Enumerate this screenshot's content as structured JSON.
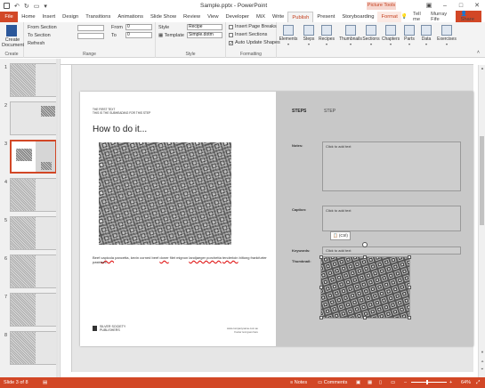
{
  "window": {
    "title": "Sample.pptx - PowerPoint",
    "contextual_tab_group": "Picture Tools"
  },
  "tabs": [
    {
      "label": "File"
    },
    {
      "label": "Home"
    },
    {
      "label": "Insert"
    },
    {
      "label": "Design"
    },
    {
      "label": "Transitions"
    },
    {
      "label": "Animations"
    },
    {
      "label": "Slide Show"
    },
    {
      "label": "Review"
    },
    {
      "label": "View"
    },
    {
      "label": "Developer"
    },
    {
      "label": "MiX"
    },
    {
      "label": "Write"
    },
    {
      "label": "Publish"
    },
    {
      "label": "Present"
    },
    {
      "label": "Storyboarding"
    },
    {
      "label": "Format"
    }
  ],
  "tab_right": {
    "tell_me": "Tell me",
    "user": "Murray Fife",
    "share": "Share"
  },
  "ribbon": {
    "create": {
      "button": "Create Document",
      "group": "Create"
    },
    "range": {
      "from_section": "From Section",
      "to_section": "To Section",
      "refresh": "Refresh",
      "from_label": "From",
      "to_label": "To",
      "from_value": "0",
      "to_value": "0",
      "group": "Range"
    },
    "style": {
      "style_label": "Style",
      "style_value": "Recipe",
      "template_label": "Template",
      "template_value": "Simple.dotm",
      "group": "Style"
    },
    "formatting": {
      "insert_page_breaks": "Insert Page Breaks",
      "insert_sections": "Insert Sections",
      "auto_update_shapes": "Auto Update Shapes",
      "group": "Formatting"
    },
    "items": [
      {
        "label": "Elements"
      },
      {
        "label": "Steps"
      },
      {
        "label": "Recipes"
      },
      {
        "label": "Thumbnails"
      },
      {
        "label": "Sections"
      },
      {
        "label": "Chapters"
      },
      {
        "label": "Parts"
      },
      {
        "label": "Data"
      },
      {
        "label": "Exercises"
      }
    ]
  },
  "thumbnails": [
    {
      "num": "1"
    },
    {
      "num": "2"
    },
    {
      "num": "3"
    },
    {
      "num": "4"
    },
    {
      "num": "5"
    },
    {
      "num": "6"
    },
    {
      "num": "7"
    },
    {
      "num": "8"
    }
  ],
  "slide": {
    "tiny_head_1": "THE FIRST TEXT",
    "tiny_head_2": "THIS IS THE SUBHEADING FOR THIS STEP",
    "title": "How to do it...",
    "caption_pre": "Beef ",
    "caption_w1": "capicola",
    "caption_mid1": " pancetta, kevin corned beef ",
    "caption_w2": "doner",
    "caption_mid2": " filet mignon ",
    "caption_w3": "landjaeger porchetta",
    "caption_w4": "tenderloin",
    "caption_post": " biltong frankfurter pastrami.",
    "logo_line1": "SILVER SOCIETY",
    "logo_line2": "PUBLISHERS",
    "footer_line1": "www.companyname.com.au",
    "footer_line2": "Footer text goes here",
    "steps_left": "STEPS",
    "steps_right": "STEP",
    "notes_label": "Notes:",
    "notes_text": "Click to add text",
    "caption_label": "Caption:",
    "caption_text": "Click to add text",
    "keywords_label": "Keywords:",
    "keywords_text": "Click to add text",
    "thumbnail_label": "Thumbnail:",
    "ctrl_badge": "(Ctrl)"
  },
  "status": {
    "slide_info": "Slide 3 of 8",
    "notes": "Notes",
    "comments": "Comments",
    "zoom": "64%"
  }
}
